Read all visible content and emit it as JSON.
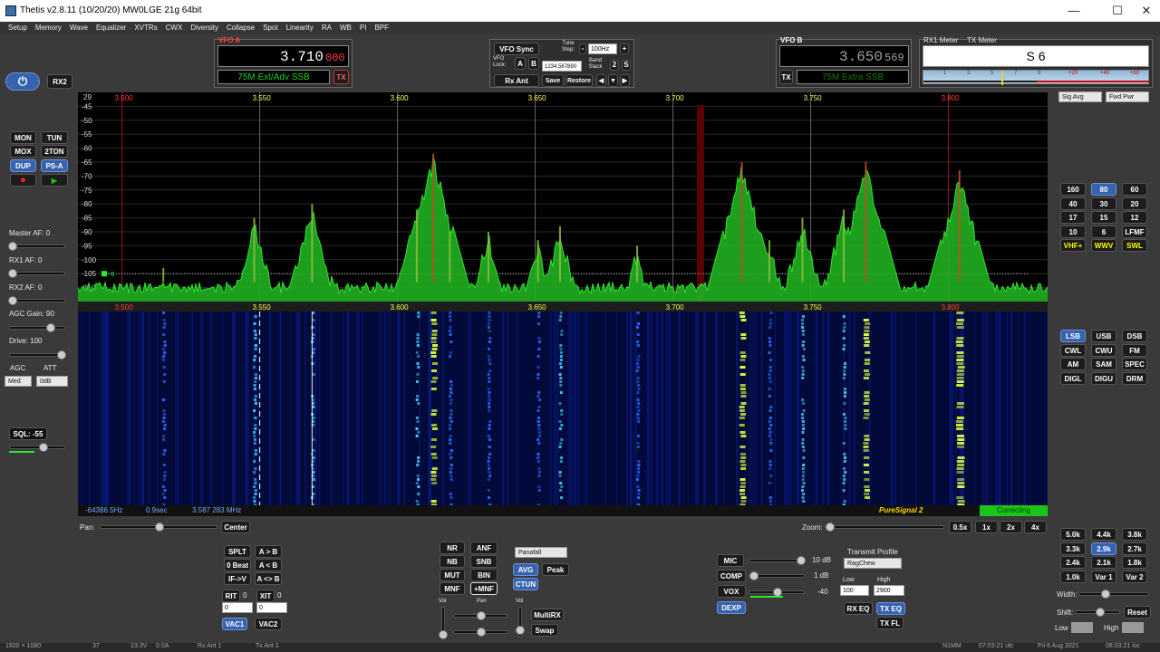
{
  "window": {
    "title": "Thetis v2.8.11 (10/20/20) MW0LGE 21g 64bit"
  },
  "menu": [
    "Setup",
    "Memory",
    "Wave",
    "Equalizer",
    "XVTRs",
    "CWX",
    "Diversity",
    "Collapse",
    "Spot",
    "Linearity",
    "RA",
    "WB",
    "PI",
    "BPF"
  ],
  "vfo_a": {
    "label": "VFO A",
    "freq_main": "3.710",
    "freq_sub": "000",
    "band": "75M Ext/Adv SSB",
    "tx": "TX"
  },
  "vfo_b": {
    "label": "VFO B",
    "freq_main": "3.650",
    "freq_sub": "569",
    "band": "75M Extra SSB",
    "tx": "TX"
  },
  "vfo_ctrl": {
    "sync": "VFO Sync",
    "tune_step_label": "Tune Step:",
    "tune_step": "100Hz",
    "vfo_lock": "VFO Lock:",
    "a": "A",
    "b": "B",
    "freq_field": "1234.567890",
    "band_stack": "Band Stack",
    "bs_val": "2",
    "bs_s": "S",
    "rx_ant": "Rx Ant",
    "save": "Save",
    "restore": "Restore",
    "arrow_l": "◀",
    "arrow_d": "▼",
    "arrow_r": "▶"
  },
  "meters": {
    "rx1": "RX1 Meter",
    "tx": "TX Meter",
    "reading": "S 6",
    "sig_avg": "Sig Avg",
    "fwd_pwr": "Fwd Pwr",
    "scale": [
      "1",
      "3",
      "5",
      "7",
      "9",
      "+20",
      "+40",
      "+60"
    ]
  },
  "power": {
    "rx2": "RX2"
  },
  "left_buttons": {
    "mon": "MON",
    "tun": "TUN",
    "mox": "MOX",
    "two_ton": "2TON",
    "dup": "DUP",
    "psa": "PS-A"
  },
  "left_controls": {
    "master_af": "Master AF:  0",
    "rx1_af": "RX1 AF:  0",
    "rx2_af": "RX2 AF:  0",
    "agc_gain": "AGC Gain:  90",
    "drive": "Drive:  100",
    "agc": "AGC",
    "att": "ATT",
    "agc_val": "Med",
    "att_val": "0dB",
    "sql": "SQL: -55"
  },
  "spectrum": {
    "top_left": "29",
    "db_labels": [
      "-45",
      "-50",
      "-55",
      "-60",
      "-65",
      "-70",
      "-75",
      "-80",
      "-85",
      "-90",
      "-95",
      "-100",
      "-105",
      "-110"
    ],
    "freq_labels": [
      "3.500",
      "3.550",
      "3.600",
      "3.650",
      "3.700",
      "3.750",
      "3.800"
    ],
    "noise_marker": "-9"
  },
  "chart_data": {
    "type": "line",
    "x_unit": "MHz",
    "y_unit": "dBm",
    "xlim": [
      3.484,
      3.836
    ],
    "ylim": [
      -115,
      -40
    ],
    "peaks": [
      {
        "x": 3.515,
        "y": -103
      },
      {
        "x": 3.548,
        "y": -85
      },
      {
        "x": 3.569,
        "y": -80
      },
      {
        "x": 3.607,
        "y": -82
      },
      {
        "x": 3.613,
        "y": -62
      },
      {
        "x": 3.619,
        "y": -90
      },
      {
        "x": 3.633,
        "y": -90
      },
      {
        "x": 3.651,
        "y": -93
      },
      {
        "x": 3.659,
        "y": -88
      },
      {
        "x": 3.687,
        "y": -95
      },
      {
        "x": 3.725,
        "y": -65
      },
      {
        "x": 3.735,
        "y": -93
      },
      {
        "x": 3.747,
        "y": -85
      },
      {
        "x": 3.762,
        "y": -82
      },
      {
        "x": 3.77,
        "y": -65
      },
      {
        "x": 3.804,
        "y": -68
      }
    ]
  },
  "status": {
    "offset": "-64386.5Hz",
    "time": "0.9sec",
    "freq": "3.587 283 MHz",
    "ps": "PureSignal 2",
    "correcting": "Correcting"
  },
  "pan": {
    "pan": "Pan:",
    "center": "Center",
    "zoom": "Zoom:",
    "z05": "0.5x",
    "z1": "1x",
    "z2": "2x",
    "z4": "4x"
  },
  "bands": [
    "160",
    "80",
    "60",
    "40",
    "30",
    "20",
    "17",
    "15",
    "12",
    "10",
    "6",
    "LFMF",
    "VHF+",
    "WWV",
    "SWL"
  ],
  "modes": [
    "LSB",
    "USB",
    "DSB",
    "CWL",
    "CWU",
    "FM",
    "AM",
    "SAM",
    "SPEC",
    "DIGL",
    "DIGU",
    "DRM"
  ],
  "filters": [
    "5.0k",
    "4.4k",
    "3.8k",
    "3.3k",
    "2.9k",
    "2.7k",
    "2.4k",
    "2.1k",
    "1.8k",
    "1.0k",
    "Var 1",
    "Var 2"
  ],
  "filter_ctrl": {
    "width": "Width:",
    "shift": "Shift:",
    "reset": "Reset",
    "low": "Low",
    "high": "High"
  },
  "bottom_left": {
    "splt": "SPLT",
    "a_b": "A > B",
    "zero_beat": "0 Beat",
    "b_a": "A < B",
    "if_v": "IF->V",
    "a_swap_b": "A <> B",
    "rit": "RIT",
    "rit_val": "0",
    "xit": "XIT",
    "xit_val": "0",
    "rit_field": "0",
    "xit_field": "0",
    "vac1": "VAC1",
    "vac2": "VAC2"
  },
  "dsp": {
    "nr": "NR",
    "anf": "ANF",
    "nb": "NB",
    "snb": "SNB",
    "mut": "MUT",
    "bin": "BIN",
    "mnf": "MNF",
    "plus_mnf": "+MNF",
    "display_mode": "Panafall",
    "avg": "AVG",
    "peak": "Peak",
    "ctun": "CTUN",
    "vol": "Vol",
    "pan": "Pan",
    "vol2": "Vol",
    "multirx": "MultiRX",
    "swap": "Swap"
  },
  "tx": {
    "mic": "MIC",
    "mic_val": "10 dB",
    "comp": "COMP",
    "comp_val": "1 dB",
    "vox": "VOX",
    "vox_val": "-40",
    "dexp": "DEXP",
    "profile_label": "Transmit Profile",
    "profile": "RagChew",
    "low": "Low",
    "high": "High",
    "low_val": "100",
    "high_val": "2900",
    "rx_eq": "RX EQ",
    "tx_eq": "TX EQ",
    "tx_fl": "TX FL"
  },
  "taskbar": {
    "res": "1920 × 1080",
    "cpu": "37",
    "volt": "13.3V",
    "amp": "0.0A",
    "rx_ant": "Rx Ant 1",
    "tx_ant": "Tx Ant 1",
    "call": "N1MM",
    "utc": "07:03:21 utc",
    "date": "Fri 6 Aug 2021",
    "local": "08:03:21 loc"
  },
  "colors": {
    "accent": "#3663b0",
    "spectrum": "#2ee82e",
    "vfo_digits": "#ffffff",
    "sub_digits": "#ff4040",
    "correcting": "#19c519"
  }
}
